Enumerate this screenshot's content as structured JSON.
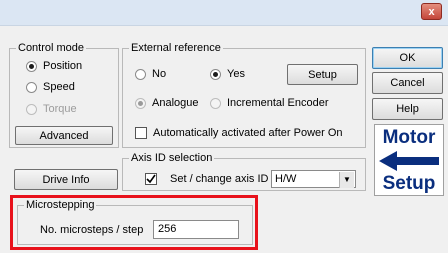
{
  "titlebar": {
    "close_label": "x"
  },
  "control_mode": {
    "legend": "Control mode",
    "options": [
      "Position",
      "Speed",
      "Torque"
    ],
    "selected": "Position",
    "advanced_label": "Advanced"
  },
  "external_reference": {
    "legend": "External reference",
    "no_label": "No",
    "yes_label": "Yes",
    "selected": "Yes",
    "setup_label": "Setup",
    "analogue_label": "Analogue",
    "incremental_label": "Incremental Encoder",
    "auto_label": "Automatically activated after Power On",
    "auto_checked": false
  },
  "right_buttons": {
    "ok": "OK",
    "cancel": "Cancel",
    "help": "Help"
  },
  "drive_info_label": "Drive Info",
  "axis_id": {
    "legend": "Axis ID selection",
    "checkbox_label": "Set / change axis ID",
    "checked": true,
    "value": "H/W"
  },
  "motor_setup": {
    "line1": "Motor",
    "line2": "Setup",
    "arrow_color": "#0a2e7e"
  },
  "microstepping": {
    "legend": "Microstepping",
    "label": "No. microsteps / step",
    "value": "256",
    "highlight_color": "#e8111b"
  }
}
